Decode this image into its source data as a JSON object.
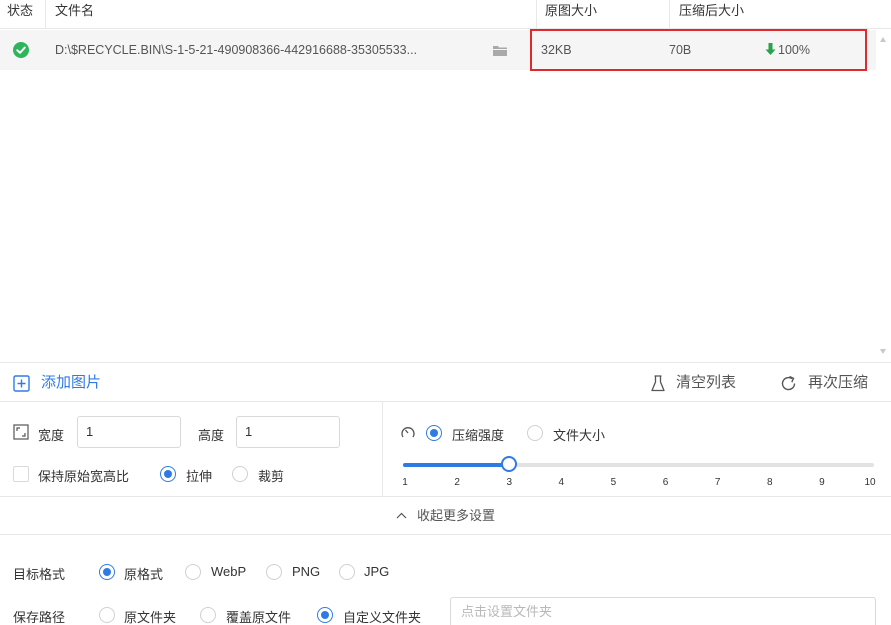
{
  "table": {
    "columns": {
      "status": "状态",
      "filename": "文件名",
      "original_size": "原图大小",
      "compressed_size": "压缩后大小"
    },
    "rows": [
      {
        "status": "success",
        "filename": "D:\\$RECYCLE.BIN\\S-1-5-21-490908366-442916688-35305533...",
        "original_size": "32KB",
        "compressed_size": "70B",
        "reduction": "100%"
      }
    ]
  },
  "toolbar": {
    "add_images": "添加图片",
    "clear_list": "清空列表",
    "recompress": "再次压缩"
  },
  "resize": {
    "width_label": "宽度",
    "width_value": "1",
    "height_label": "高度",
    "height_value": "1",
    "keep_ratio_label": "保持原始宽高比",
    "keep_ratio_checked": false,
    "mode_options": [
      "拉伸",
      "裁剪"
    ],
    "mode_selected": "拉伸"
  },
  "compression": {
    "mode_options": [
      "压缩强度",
      "文件大小"
    ],
    "mode_selected": "压缩强度",
    "slider_ticks": [
      "1",
      "2",
      "3",
      "4",
      "5",
      "6",
      "7",
      "8",
      "9",
      "10"
    ],
    "slider_value": 3,
    "slider_min": 1,
    "slider_max": 10
  },
  "collapse_label": "收起更多设置",
  "target_format": {
    "label": "目标格式",
    "options": [
      "原格式",
      "WebP",
      "PNG",
      "JPG"
    ],
    "selected": "原格式"
  },
  "save_path": {
    "label": "保存路径",
    "options": [
      "原文件夹",
      "覆盖原文件",
      "自定义文件夹"
    ],
    "selected": "自定义文件夹",
    "placeholder": "点击设置文件夹"
  },
  "colors": {
    "accent": "#2f7be5",
    "success": "#2eb55c",
    "highlight_border": "#e0282e"
  }
}
